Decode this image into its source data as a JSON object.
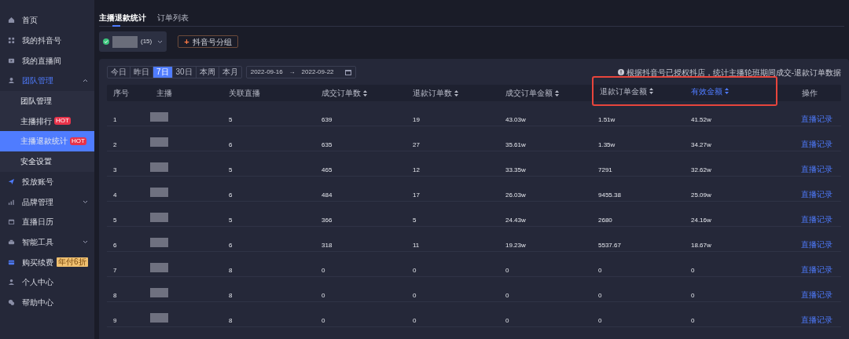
{
  "sidebar": {
    "items": [
      {
        "label": "首页",
        "selected": false
      },
      {
        "label": "我的抖音号",
        "selected": false
      },
      {
        "label": "我的直播间",
        "selected": false
      },
      {
        "label": "团队管理",
        "selected": false,
        "expanded": true,
        "children": [
          {
            "label": "团队管理",
            "selected": false
          },
          {
            "label": "主播排行",
            "badge": "HOT",
            "selected": false
          },
          {
            "label": "主播退款统计",
            "badge": "HOT",
            "selected": true
          },
          {
            "label": "安全设置",
            "selected": false
          }
        ]
      },
      {
        "label": "投放账号",
        "selected": false
      },
      {
        "label": "品牌管理",
        "selected": false,
        "expanded": false
      },
      {
        "label": "直播日历",
        "selected": false
      },
      {
        "label": "智能工具",
        "selected": false,
        "expanded": false
      },
      {
        "label": "购买续费",
        "selected": false,
        "promo": "年付6折"
      },
      {
        "label": "个人中心",
        "selected": false
      },
      {
        "label": "帮助中心",
        "selected": false
      }
    ]
  },
  "tabs": [
    {
      "label": "主播退款统计",
      "selected": true
    },
    {
      "label": "订单列表",
      "selected": false
    }
  ],
  "account": {
    "count": "(15)"
  },
  "group_button": {
    "icon": "+",
    "label": "抖音号分组"
  },
  "periods": [
    {
      "label": "今日",
      "selected": false
    },
    {
      "label": "昨日",
      "selected": false
    },
    {
      "label": "7日",
      "selected": true
    },
    {
      "label": "30日",
      "selected": false
    },
    {
      "label": "本周",
      "selected": false
    },
    {
      "label": "本月",
      "selected": false
    }
  ],
  "date_range": {
    "start": "2022-09-16",
    "separator": "→",
    "end": "2022-09-22"
  },
  "note": "根据抖音号已授权抖店，统计主播轮班期间成交-退款订单数据",
  "table": {
    "columns": [
      {
        "label": "序号",
        "sortable": false,
        "sorted": false,
        "highlighted": false
      },
      {
        "label": "主播",
        "sortable": false,
        "sorted": false,
        "highlighted": false
      },
      {
        "label": "关联直播",
        "sortable": false,
        "sorted": false,
        "highlighted": false
      },
      {
        "label": "成交订单数",
        "sortable": true,
        "sorted": false,
        "highlighted": false
      },
      {
        "label": "退款订单数",
        "sortable": true,
        "sorted": false,
        "highlighted": false
      },
      {
        "label": "成交订单金额",
        "sortable": true,
        "sorted": false,
        "highlighted": false
      },
      {
        "label": "退款订单金额",
        "sortable": true,
        "sorted": false,
        "highlighted": true
      },
      {
        "label": "有效金额",
        "sortable": true,
        "sorted": true,
        "highlighted": true
      },
      {
        "label": "操作",
        "sortable": false,
        "sorted": false,
        "highlighted": false
      }
    ],
    "rows": [
      [
        "1",
        "",
        "5",
        "639",
        "19",
        "43.03w",
        "1.51w",
        "41.52w",
        "直播记录"
      ],
      [
        "2",
        "",
        "6",
        "635",
        "27",
        "35.61w",
        "1.35w",
        "34.27w",
        "直播记录"
      ],
      [
        "3",
        "",
        "5",
        "465",
        "12",
        "33.35w",
        "7291",
        "32.62w",
        "直播记录"
      ],
      [
        "4",
        "",
        "6",
        "484",
        "17",
        "26.03w",
        "9455.38",
        "25.09w",
        "直播记录"
      ],
      [
        "5",
        "",
        "5",
        "366",
        "5",
        "24.43w",
        "2680",
        "24.16w",
        "直播记录"
      ],
      [
        "6",
        "",
        "6",
        "318",
        "11",
        "19.23w",
        "5537.67",
        "18.67w",
        "直播记录"
      ],
      [
        "7",
        "",
        "8",
        "0",
        "0",
        "0",
        "0",
        "0",
        "直播记录"
      ],
      [
        "8",
        "",
        "8",
        "0",
        "0",
        "0",
        "0",
        "0",
        "直播记录"
      ],
      [
        "9",
        "",
        "8",
        "0",
        "0",
        "0",
        "0",
        "0",
        "直播记录"
      ]
    ]
  }
}
